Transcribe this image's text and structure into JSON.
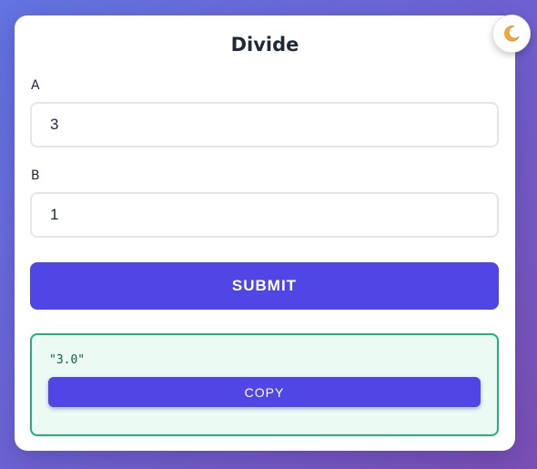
{
  "title": "Divide",
  "fields": {
    "a": {
      "label": "A",
      "value": "3"
    },
    "b": {
      "label": "B",
      "value": "1"
    }
  },
  "submit_label": "SUBMIT",
  "result": {
    "text": "\"3.0\"",
    "copy_label": "COPY"
  },
  "theme_toggle": {
    "icon": "moon-icon"
  },
  "colors": {
    "accent": "#4f46e5",
    "result_border": "#22b07d",
    "result_bg": "#ebfbf4",
    "moon": "#f2a93b"
  }
}
